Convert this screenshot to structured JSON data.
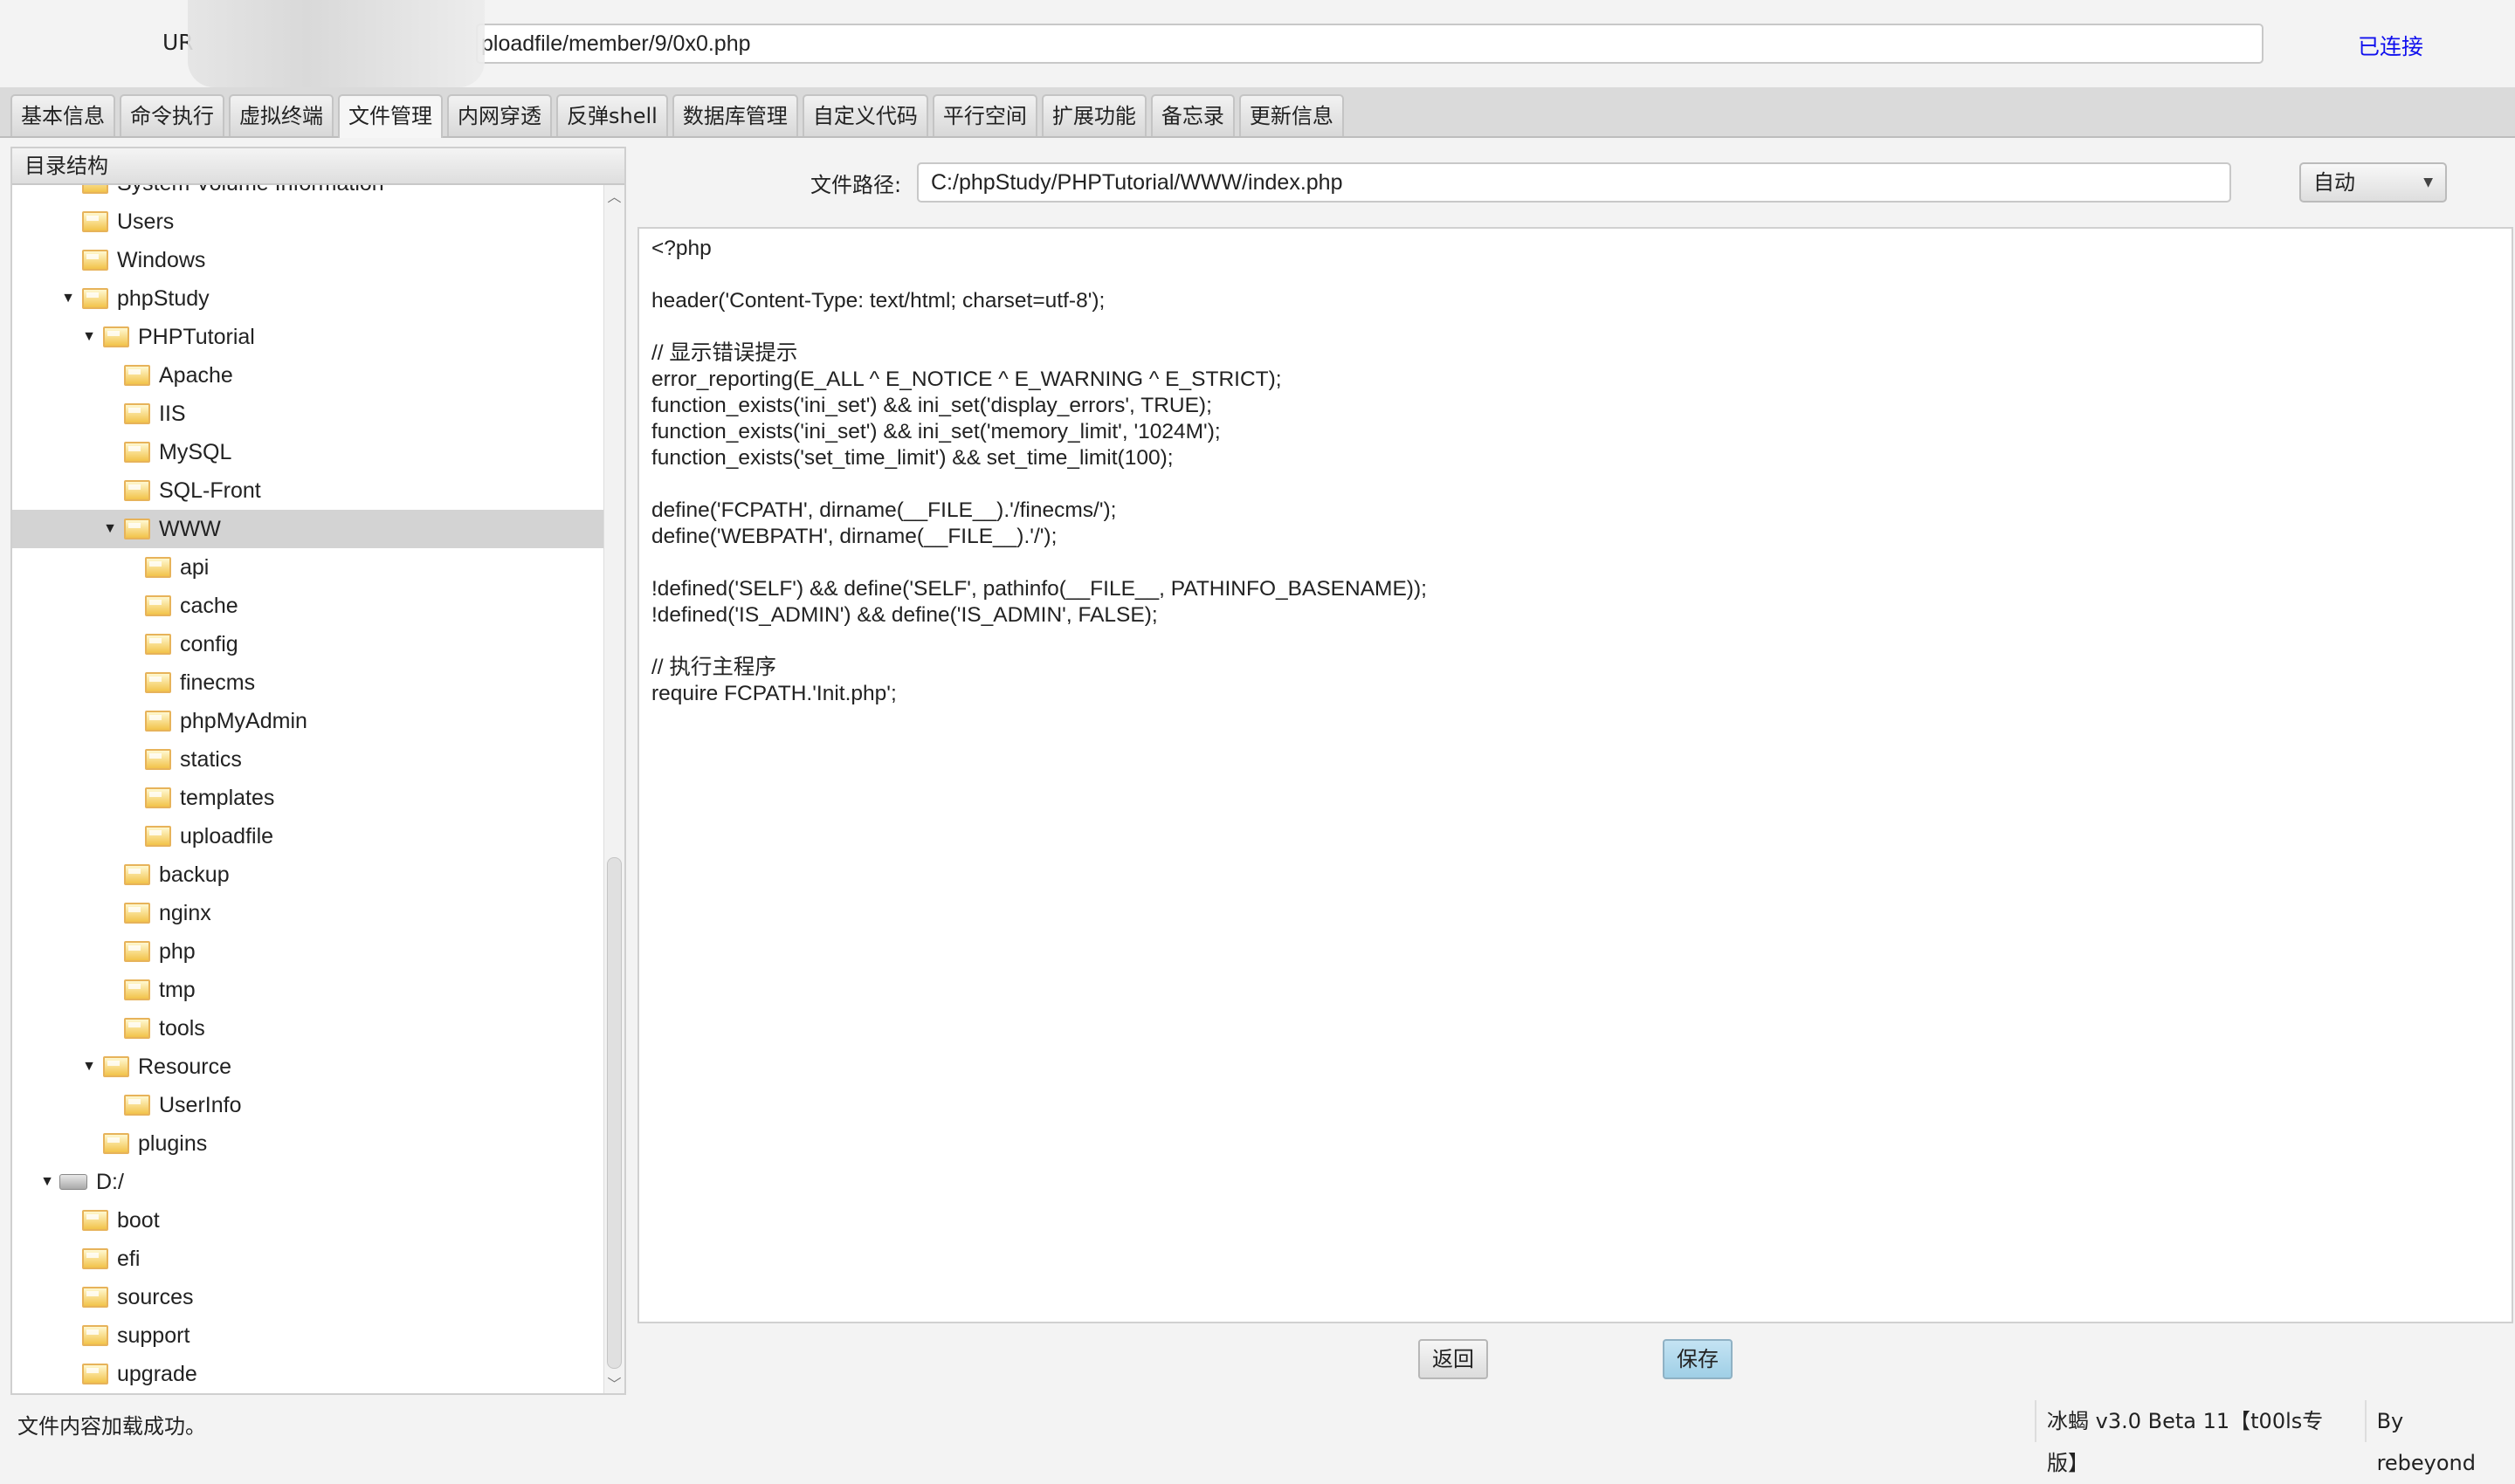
{
  "header": {
    "url_label": "UR",
    "url_value": "ploadfile/member/9/0x0.php",
    "connection_status": "已连接"
  },
  "tabs": [
    {
      "label": "基本信息"
    },
    {
      "label": "命令执行"
    },
    {
      "label": "虚拟终端"
    },
    {
      "label": "文件管理",
      "active": true
    },
    {
      "label": "内网穿透"
    },
    {
      "label": "反弹shell"
    },
    {
      "label": "数据库管理"
    },
    {
      "label": "自定义代码"
    },
    {
      "label": "平行空间"
    },
    {
      "label": "扩展功能"
    },
    {
      "label": "备忘录"
    },
    {
      "label": "更新信息"
    }
  ],
  "tree": {
    "title": "目录结构",
    "items": [
      {
        "label": "System Volume Information",
        "depth": 1
      },
      {
        "label": "Users",
        "depth": 1
      },
      {
        "label": "Windows",
        "depth": 1
      },
      {
        "label": "phpStudy",
        "depth": 1,
        "expanded": true
      },
      {
        "label": "PHPTutorial",
        "depth": 2,
        "expanded": true
      },
      {
        "label": "Apache",
        "depth": 3
      },
      {
        "label": "IIS",
        "depth": 3
      },
      {
        "label": "MySQL",
        "depth": 3
      },
      {
        "label": "SQL-Front",
        "depth": 3
      },
      {
        "label": "WWW",
        "depth": 3,
        "expanded": true,
        "selected": true
      },
      {
        "label": "api",
        "depth": 4
      },
      {
        "label": "cache",
        "depth": 4
      },
      {
        "label": "config",
        "depth": 4
      },
      {
        "label": "finecms",
        "depth": 4
      },
      {
        "label": "phpMyAdmin",
        "depth": 4
      },
      {
        "label": "statics",
        "depth": 4
      },
      {
        "label": "templates",
        "depth": 4
      },
      {
        "label": "uploadfile",
        "depth": 4
      },
      {
        "label": "backup",
        "depth": 3
      },
      {
        "label": "nginx",
        "depth": 3
      },
      {
        "label": "php",
        "depth": 3
      },
      {
        "label": "tmp",
        "depth": 3
      },
      {
        "label": "tools",
        "depth": 3
      },
      {
        "label": "Resource",
        "depth": 2,
        "expanded": true
      },
      {
        "label": "UserInfo",
        "depth": 3
      },
      {
        "label": "plugins",
        "depth": 2
      },
      {
        "label": "D:/",
        "depth": 0,
        "expanded": true,
        "drive": true
      },
      {
        "label": "boot",
        "depth": 1
      },
      {
        "label": "efi",
        "depth": 1
      },
      {
        "label": "sources",
        "depth": 1
      },
      {
        "label": "support",
        "depth": 1
      },
      {
        "label": "upgrade",
        "depth": 1
      }
    ]
  },
  "file": {
    "path_label": "文件路径:",
    "path_value": "C:/phpStudy/PHPTutorial/WWW/index.php",
    "encoding": "自动"
  },
  "editor": {
    "lines": [
      "<?php",
      "",
      "header('Content-Type: text/html; charset=utf-8');",
      "",
      "// 显示错误提示",
      "error_reporting(E_ALL ^ E_NOTICE ^ E_WARNING ^ E_STRICT);",
      "function_exists('ini_set') && ini_set('display_errors', TRUE);",
      "function_exists('ini_set') && ini_set('memory_limit', '1024M');",
      "function_exists('set_time_limit') && set_time_limit(100);",
      "",
      "define('FCPATH', dirname(__FILE__).'/finecms/');",
      "define('WEBPATH', dirname(__FILE__).'/');",
      "",
      "!defined('SELF') && define('SELF', pathinfo(__FILE__, PATHINFO_BASENAME));",
      "!defined('IS_ADMIN') && define('IS_ADMIN', FALSE);",
      "",
      "// 执行主程序",
      "require FCPATH.'Init.php';"
    ]
  },
  "buttons": {
    "back": "返回",
    "save": "保存"
  },
  "statusbar": {
    "message": "文件内容加载成功。",
    "version": "冰蝎 v3.0 Beta 11【t00ls专版】",
    "author": "By rebeyond"
  },
  "colors": {
    "connected": "#1010ee",
    "selected_row": "#d3d3d3",
    "save_button": "#a9d5ea"
  }
}
